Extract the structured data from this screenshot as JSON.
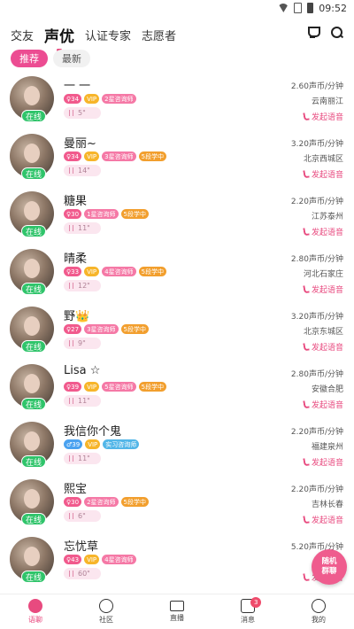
{
  "status_bar": {
    "time": "09:52"
  },
  "top_tabs": [
    {
      "label": "交友"
    },
    {
      "label": "声优"
    },
    {
      "label": "认证专家"
    },
    {
      "label": "志愿者"
    }
  ],
  "sub_tabs": [
    {
      "label": "推荐"
    },
    {
      "label": "最新"
    }
  ],
  "online_label": "在线",
  "call_label": "发起语音",
  "users": [
    {
      "name": "一 一",
      "age": "34",
      "gender": "female",
      "vip": "VIP",
      "rank": "2星咨询师",
      "hot": "",
      "voice": "5\"",
      "price": "2.60声币/分钟",
      "location": "云南丽江"
    },
    {
      "name": "曼丽~",
      "age": "34",
      "gender": "female",
      "vip": "VIP",
      "rank": "3星咨询师",
      "hot": "5段学中",
      "voice": "14\"",
      "price": "3.20声币/分钟",
      "location": "北京西城区"
    },
    {
      "name": "糖果",
      "age": "30",
      "gender": "female",
      "vip": "",
      "rank": "1星咨询师",
      "hot": "5段学中",
      "voice": "11\"",
      "price": "2.20声币/分钟",
      "location": "江苏泰州"
    },
    {
      "name": "晴柔",
      "age": "33",
      "gender": "female",
      "vip": "VIP",
      "rank": "4星咨询师",
      "hot": "5段学中",
      "voice": "12\"",
      "price": "2.80声币/分钟",
      "location": "河北石家庄"
    },
    {
      "name": "野👑",
      "age": "27",
      "gender": "female",
      "vip": "",
      "rank": "3星咨询师",
      "hot": "5段学中",
      "voice": "9\"",
      "price": "3.20声币/分钟",
      "location": "北京东城区"
    },
    {
      "name": "Lisa ☆",
      "age": "39",
      "gender": "female",
      "vip": "VIP",
      "rank": "5星咨询师",
      "hot": "5段学中",
      "voice": "11\"",
      "price": "2.80声币/分钟",
      "location": "安徽合肥"
    },
    {
      "name": "我信你个鬼",
      "age": "39",
      "gender": "male",
      "vip": "VIP",
      "rank": "实习咨询师",
      "hot": "",
      "voice": "11\"",
      "price": "2.20声币/分钟",
      "location": "福建泉州"
    },
    {
      "name": "熙宝",
      "age": "30",
      "gender": "female",
      "vip": "",
      "rank": "2星咨询师",
      "hot": "5段学中",
      "voice": "6\"",
      "price": "2.20声币/分钟",
      "location": "吉林长春"
    },
    {
      "name": "忘忧草",
      "age": "43",
      "gender": "female",
      "vip": "VIP",
      "rank": "4星咨询师",
      "hot": "",
      "voice": "60\"",
      "price": "5.20声币/分钟",
      "location": ""
    }
  ],
  "float_button": {
    "line1": "随机",
    "line2": "群聊"
  },
  "bottom_tabs": [
    {
      "label": "语聊"
    },
    {
      "label": "社区"
    },
    {
      "label": "直播"
    },
    {
      "label": "消息",
      "badge": "3"
    },
    {
      "label": "我的"
    }
  ]
}
